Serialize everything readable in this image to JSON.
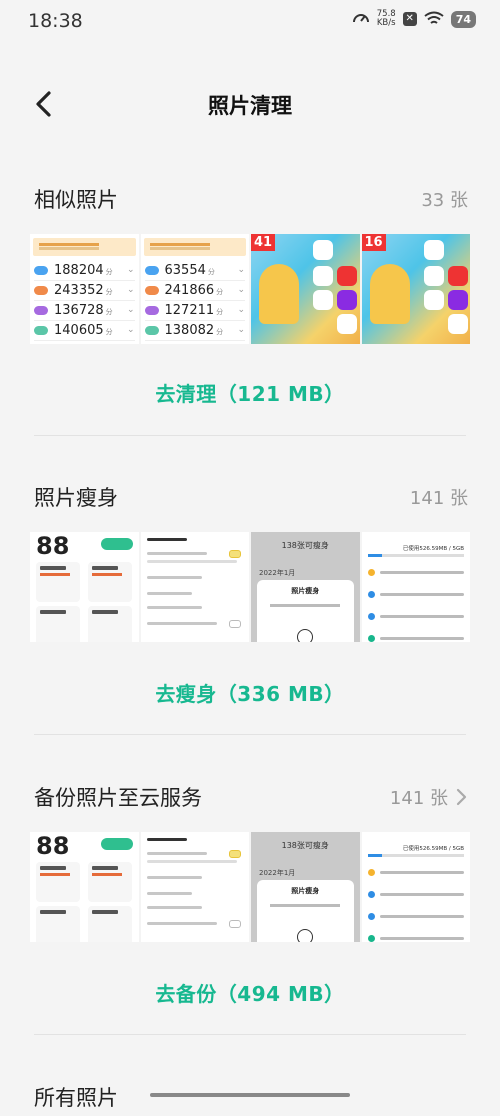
{
  "status": {
    "time": "18:38",
    "net_speed": "75.8",
    "net_unit": "KB/s",
    "battery": "74"
  },
  "header": {
    "title": "照片清理"
  },
  "sections": [
    {
      "title": "相似照片",
      "count": "33 张",
      "action": "去清理（121 MB）"
    },
    {
      "title": "照片瘦身",
      "count": "141 张",
      "action": "去瘦身（336 MB）"
    },
    {
      "title": "备份照片至云服务",
      "count": "141 张",
      "action": "去备份（494 MB）"
    },
    {
      "title": "所有照片"
    }
  ],
  "thumbs": {
    "scores_a": [
      "188204",
      "243352",
      "136728",
      "140605"
    ],
    "scores_b": [
      "63554",
      "241866",
      "127211",
      "138082"
    ],
    "score_unit": "分",
    "home_badge_1": "41",
    "home_badge_2": "16",
    "big_88": "88",
    "slim_title": "138张可瘦身",
    "slim_date": "2022年1月",
    "slim_sheet": "照片瘦身",
    "cloud_header": "已使用526.59MB / 5GB"
  },
  "colors": {
    "accent": "#17b890",
    "background": "#f4f4f4"
  }
}
